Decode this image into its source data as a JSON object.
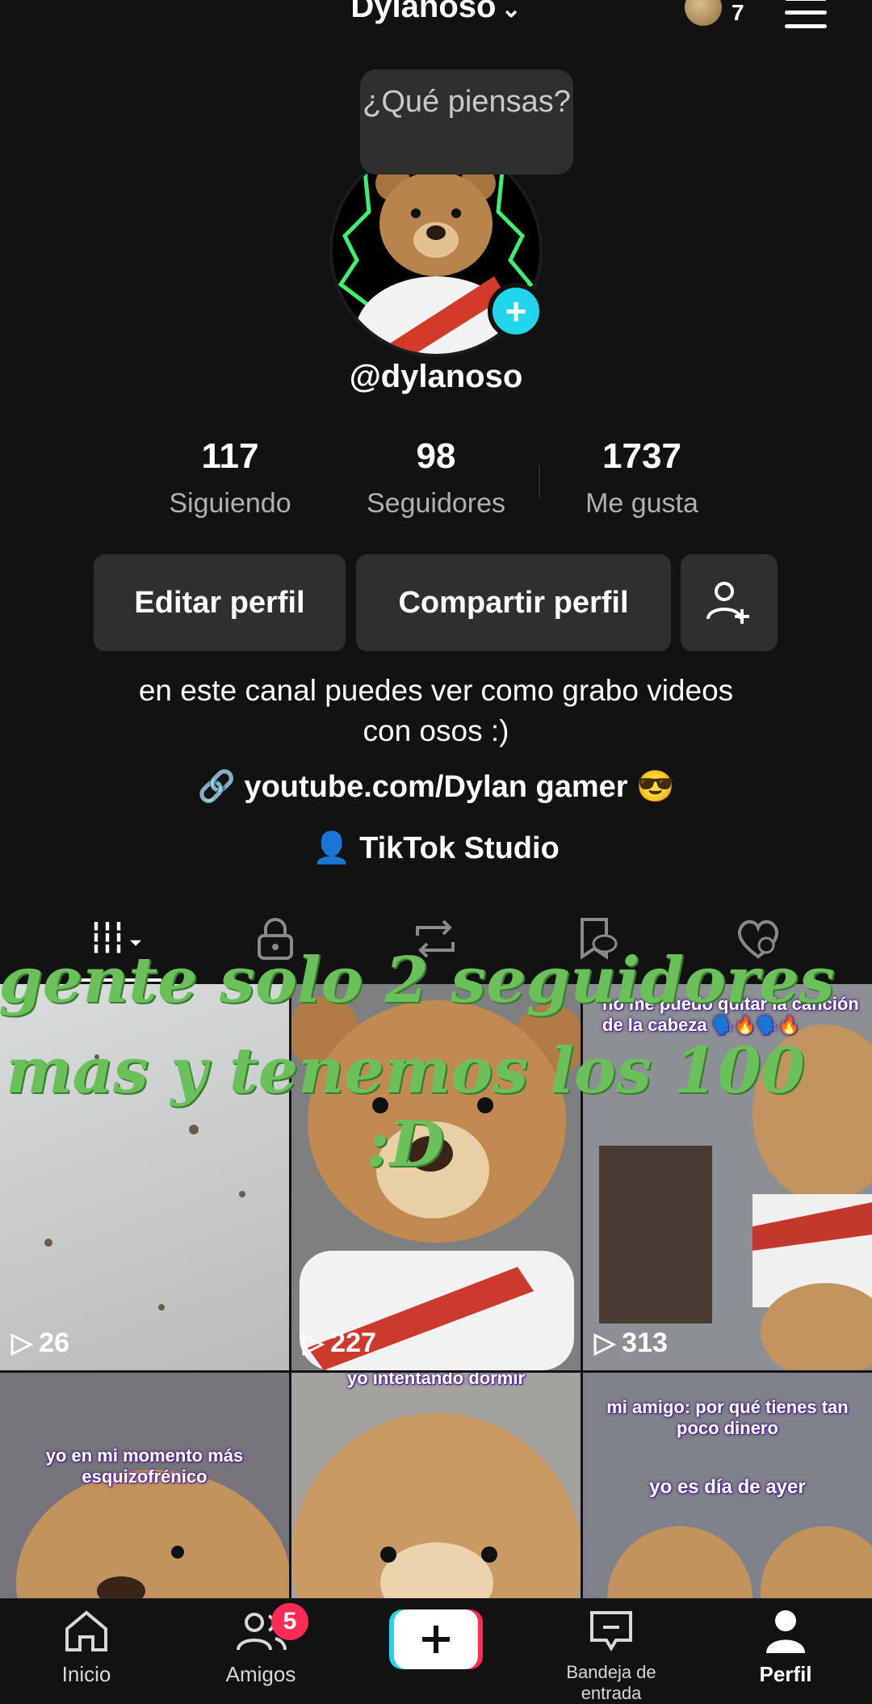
{
  "header": {
    "username": "Dylanoso",
    "notification_count": "7"
  },
  "profile": {
    "bubble_text": "¿Qué piensas?",
    "handle": "@dylanoso",
    "stats": [
      {
        "value": "117",
        "label": "Siguiendo"
      },
      {
        "value": "98",
        "label": "Seguidores"
      },
      {
        "value": "1737",
        "label": "Me gusta"
      }
    ],
    "edit_label": "Editar perfil",
    "share_label": "Compartir perfil",
    "bio_line1": "en este canal puedes ver como grabo videos",
    "bio_line2": "con osos :)",
    "link": "youtube.com/Dylan gamer 😎",
    "studio": "TikTok Studio"
  },
  "overlay": {
    "line1": "gente solo 2 seguidores",
    "line2": "mas y tenemos los 100 :D"
  },
  "videos": [
    {
      "views": "26",
      "caption": ""
    },
    {
      "views": "227",
      "caption": ""
    },
    {
      "views": "313",
      "caption": "no me puedo quitar la canción de la cabeza 🗣️🔥🗣️🔥"
    },
    {
      "views": "",
      "caption": "yo en mi momento más esquizofrénico"
    },
    {
      "views": "",
      "caption": "yo intentando dormir"
    },
    {
      "views": "",
      "caption": "mi amigo: por qué tienes tan poco dinero"
    },
    {
      "views": "",
      "caption": "yo es día de ayer"
    }
  ],
  "nav": {
    "home": "Inicio",
    "friends": "Amigos",
    "friends_badge": "5",
    "inbox": "Bandeja de entrada",
    "profile": "Perfil"
  },
  "colors": {
    "accent_cyan": "#20d5ec",
    "accent_red": "#fe2c55",
    "overlay_green": "#6ac15a"
  }
}
